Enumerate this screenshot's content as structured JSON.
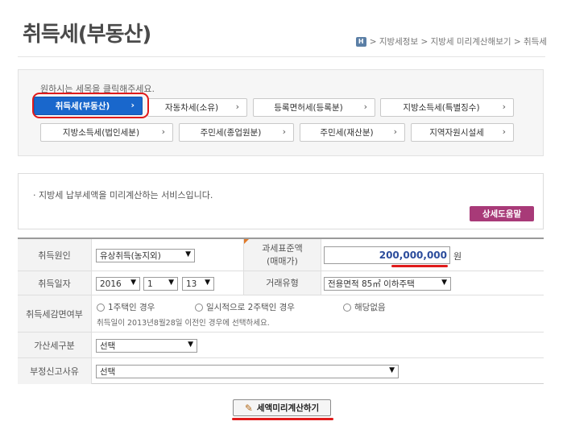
{
  "header": {
    "title": "취득세(부동산)",
    "breadcrumb": {
      "home_icon_label": "H",
      "path": "> 지방세정보 > 지방세 미리계산해보기 > 취득세"
    }
  },
  "tax_selector": {
    "guide": "원하시는 세목을 클릭해주세요.",
    "items": [
      {
        "label": "취득세(부동산)",
        "active": true
      },
      {
        "label": "자동차세(소유)"
      },
      {
        "label": "등록면허세(등록분)"
      },
      {
        "label": "지방소득세(특별징수)"
      },
      {
        "label": "지방소득세(법인세분)"
      },
      {
        "label": "주민세(종업원분)"
      },
      {
        "label": "주민세(재산분)"
      },
      {
        "label": "지역자원시설세"
      }
    ],
    "chevron": "›"
  },
  "info": {
    "text": "· 지방세 납부세액을 미리계산하는 서비스입니다.",
    "help_button": "상세도움말"
  },
  "form": {
    "acquisition_cause": {
      "label": "취득원인",
      "value": "유상취득(농지외)"
    },
    "tax_base": {
      "label_line1": "과세표준액",
      "label_line2": "(매매가)",
      "value": "200,000,000",
      "unit": "원"
    },
    "acquisition_date": {
      "label": "취득일자",
      "year": "2016",
      "month": "1",
      "day": "13"
    },
    "transaction_type": {
      "label": "거래유형",
      "value": "전용면적 85㎡ 이하주택"
    },
    "reduction": {
      "label": "취득세감면여부",
      "options": [
        "1주택인 경우",
        "일시적으로 2주택인 경우",
        "해당없음"
      ],
      "note": "취득일이 2013년8월28일 이전인 경우에 선택하세요."
    },
    "surcharge": {
      "label": "가산세구분",
      "value": "선택"
    },
    "improper_report": {
      "label": "부정신고사유",
      "value": "선택"
    }
  },
  "actions": {
    "calculate_button": "세액미리계산하기"
  },
  "colors": {
    "active_tab": "#1967cc",
    "help_button": "#a83a78",
    "amount_text": "#2b4c9c",
    "annotation_red": "#e01b1b"
  }
}
